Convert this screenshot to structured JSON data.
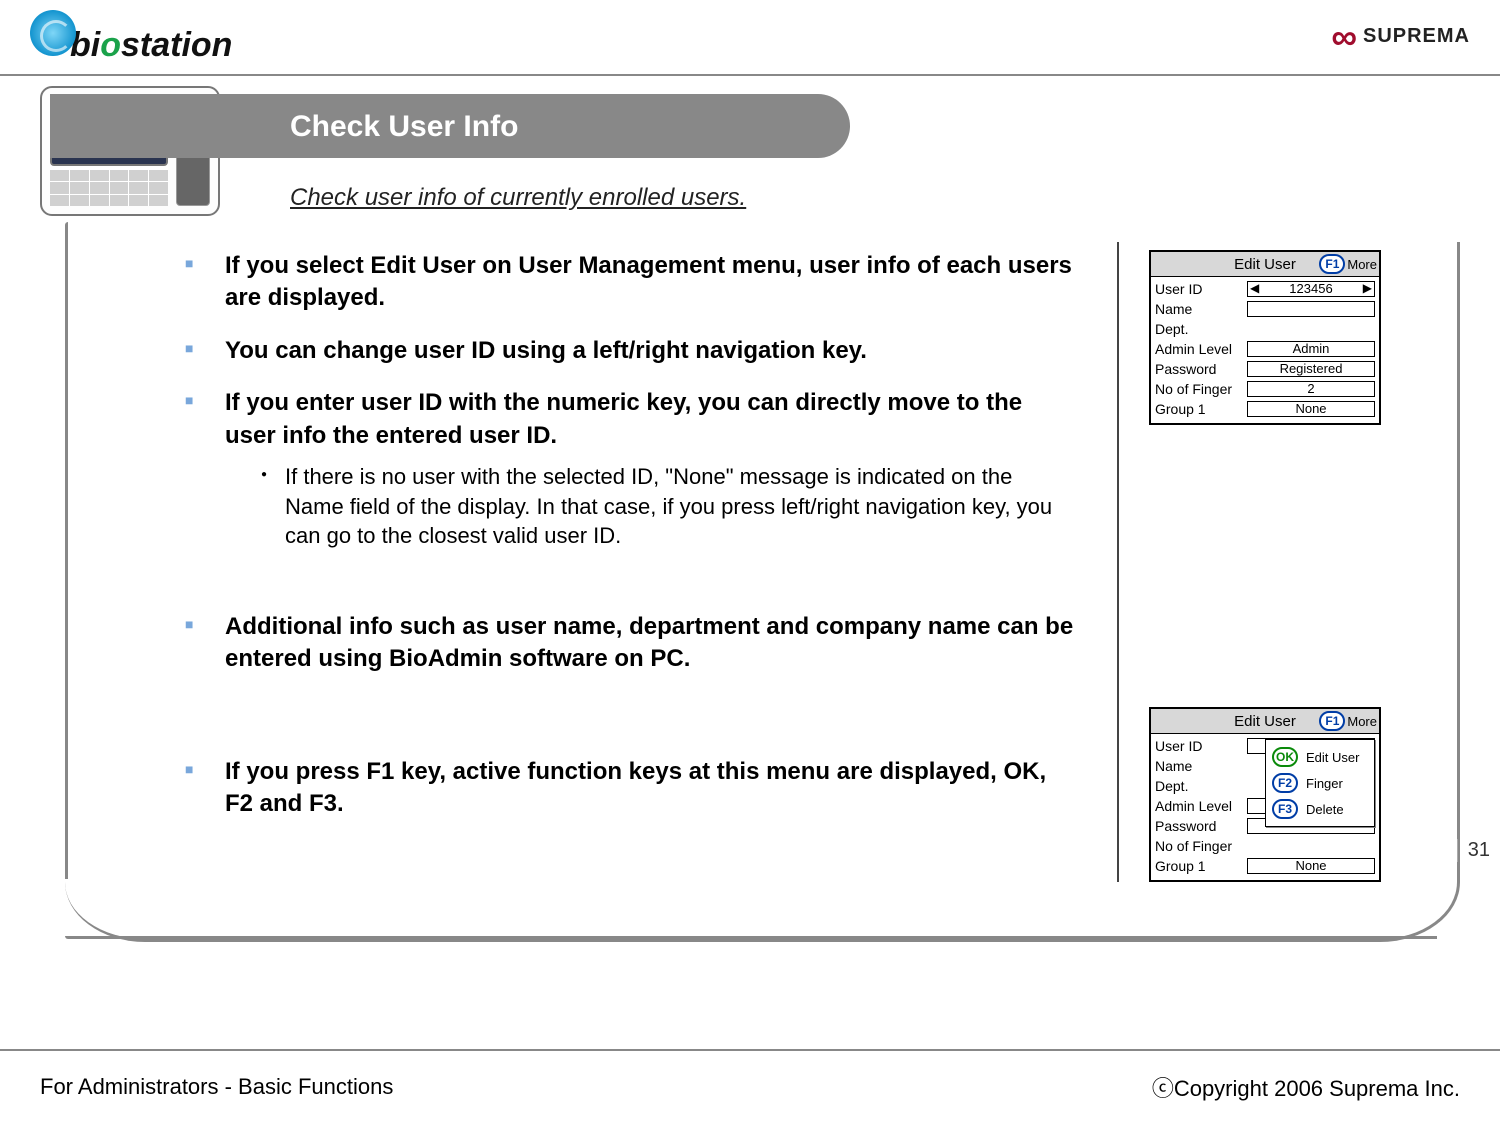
{
  "brands": {
    "left_bi": "bi",
    "left_o": "o",
    "left_st": "station",
    "right": "SUPREMA"
  },
  "title": "Check User Info",
  "subtitle": "Check user info of currently enrolled users.",
  "bullets": {
    "b1": "If you select Edit User on User Management menu, user info of each users are displayed.",
    "b2": "You can change user ID using a left/right navigation key.",
    "b3": "If you enter user ID with the numeric key, you can directly move to the user info the entered user ID.",
    "b3_sub1": "If there is no user with the selected ID, \"None\" message is indicated on the Name field of the display. In that case, if you press left/right navigation key, you can go to the closest valid user ID.",
    "b4": "Additional info such as user name, department and company name can be entered using BioAdmin software on PC.",
    "b5": "If you press F1 key, active function keys at this menu are displayed, OK, F2 and F3."
  },
  "panel1": {
    "title": "Edit User",
    "f1": "F1",
    "more": "More",
    "rows": {
      "user_id_lbl": "User ID",
      "user_id_val": "123456",
      "name_lbl": "Name",
      "name_val": "",
      "dept_lbl": "Dept.",
      "dept_val": "",
      "admin_lbl": "Admin Level",
      "admin_val": "Admin",
      "pwd_lbl": "Password",
      "pwd_val": "Registered",
      "fingers_lbl": "No of Finger",
      "fingers_val": "2",
      "group_lbl": "Group 1",
      "group_val": "None"
    }
  },
  "panel2": {
    "title": "Edit User",
    "f1": "F1",
    "more": "More",
    "rows": {
      "user_id_lbl": "User ID",
      "name_lbl": "Name",
      "dept_lbl": "Dept.",
      "admin_lbl": "Admin Level",
      "pwd_lbl": "Password",
      "fingers_lbl": "No of Finger",
      "group_lbl": "Group 1",
      "group_val": "None"
    },
    "menu": {
      "ok_key": "OK",
      "ok_lbl": "Edit User",
      "f2_key": "F2",
      "f2_lbl": "Finger",
      "f3_key": "F3",
      "f3_lbl": "Delete"
    }
  },
  "footer": {
    "left": "For Administrators - Basic Functions",
    "right": "ⓒCopyright 2006 Suprema Inc."
  },
  "page_number": "31",
  "thumb_label": "biostation"
}
